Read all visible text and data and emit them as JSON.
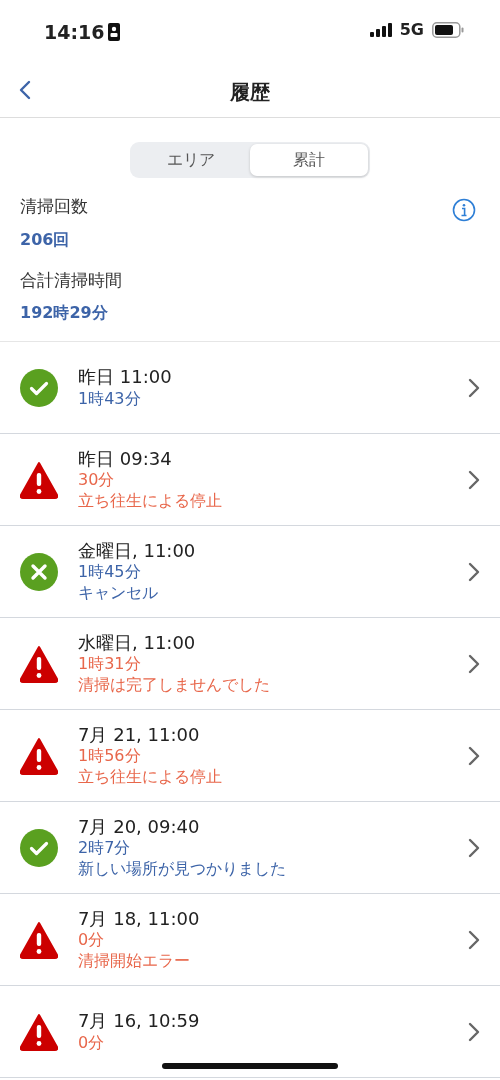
{
  "status_bar": {
    "time": "14:16",
    "network": "5G"
  },
  "nav": {
    "title": "履歴"
  },
  "segments": [
    {
      "label": "エリア",
      "selected": false
    },
    {
      "label": "累計",
      "selected": true
    }
  ],
  "stats": [
    {
      "label": "清掃回数",
      "value": "206回"
    },
    {
      "label": "合計清掃時間",
      "value": "192時29分"
    }
  ],
  "history": [
    {
      "kind": "success",
      "title": "昨日 11:00",
      "duration": "1時43分"
    },
    {
      "kind": "error",
      "title": "昨日 09:34",
      "duration": "30分",
      "note": "立ち往生による停止"
    },
    {
      "kind": "cancelled",
      "title": "金曜日, 11:00",
      "duration": "1時45分",
      "note": "キャンセル"
    },
    {
      "kind": "error",
      "title": "水曜日, 11:00",
      "duration": "1時31分",
      "note": "清掃は完了しませんでした"
    },
    {
      "kind": "error",
      "title": "7月 21, 11:00",
      "duration": "1時56分",
      "note": "立ち往生による停止"
    },
    {
      "kind": "success",
      "title": "7月 20, 09:40",
      "duration": "2時7分",
      "note": "新しい場所が見つかりました"
    },
    {
      "kind": "error",
      "title": "7月 18, 11:00",
      "duration": "0分",
      "note": "清掃開始エラー"
    },
    {
      "kind": "error",
      "title": "7月 16, 10:59",
      "duration": "0分"
    }
  ]
}
